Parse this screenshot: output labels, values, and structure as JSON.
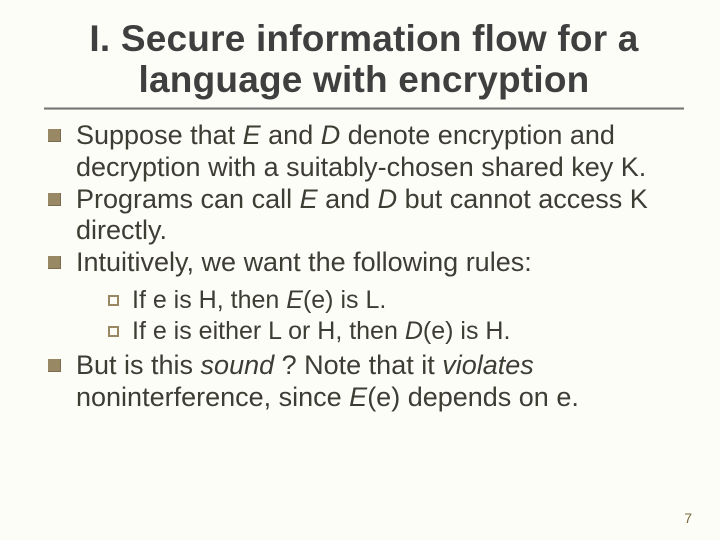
{
  "title_line1": "I. Secure information flow for a",
  "title_line2": "language with encryption",
  "bullets": {
    "b1_a": "Suppose that ",
    "b1_E": "E",
    "b1_b": " and ",
    "b1_D": "D",
    "b1_c": " denote encryption and decryption with a suitably-chosen shared key K.",
    "b2_a": "Programs can call ",
    "b2_E": "E",
    "b2_b": " and ",
    "b2_D": "D",
    "b2_c": " but cannot access K directly.",
    "b3": "Intuitively, we want the following rules:",
    "s1_a": "If e is H, then ",
    "s1_E": "E",
    "s1_b": "(e) is L.",
    "s2_a": "If e is either L or H, then ",
    "s2_D": "D",
    "s2_b": "(e) is H.",
    "b4_a": "But is this ",
    "b4_sound": "sound",
    "b4_b": " ?  Note that it ",
    "b4_violates": "violates",
    "b4_c": " noninterference, since ",
    "b4_E": "E",
    "b4_d": "(e) depends on e."
  },
  "slide_number": "7"
}
